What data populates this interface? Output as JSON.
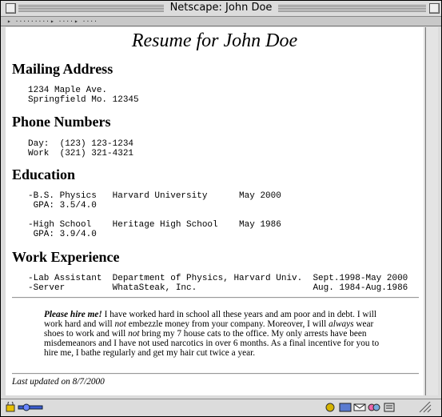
{
  "window": {
    "title": "Netscape: John Doe"
  },
  "tabs": [
    "▸ ·········",
    "▸ ····",
    "▸ ····"
  ],
  "resume": {
    "heading": "Resume for John Doe",
    "sections": {
      "mailing": {
        "title": "Mailing Address",
        "lines": [
          "1234 Maple Ave.",
          "Springfield Mo. 12345"
        ]
      },
      "phone": {
        "title": "Phone Numbers",
        "lines": [
          "Day:  (123) 123-1234",
          "Work  (321) 321-4321"
        ]
      },
      "education": {
        "title": "Education",
        "entries": [
          {
            "line1": "-B.S. Physics   Harvard University      May 2000",
            "line2": " GPA: 3.5/4.0"
          },
          {
            "line1": "-High School    Heritage High School    May 1986",
            "line2": " GPA: 3.9/4.0"
          }
        ]
      },
      "work": {
        "title": "Work Experience",
        "lines": [
          "-Lab Assistant  Department of Physics, Harvard Univ.  Sept.1998-May 2000",
          "-Server         WhataSteak, Inc.                      Aug. 1984-Aug.1986"
        ]
      }
    },
    "plea": {
      "lead": "Please hire me!",
      "t1": " I have worked hard in school all these years and am poor and in debt. I will work hard and will ",
      "em1": "not",
      "t2": " embezzle money from your company. Moreover, I will ",
      "em2": "always",
      "t3": " wear shoes to work and will ",
      "em3": "not",
      "t4": " bring my 7 house cats to the office. My only arrests have been misdemeanors and I have not used narcotics in over 6 months. As a final incentive for you to hire me, I bathe regularly and get my hair cut twice a year."
    },
    "updated": "Last updated on 8/7/2000"
  },
  "icons": {
    "status_left": [
      "lock-icon",
      "connection-icon"
    ],
    "status_right": [
      "gear-icon",
      "network-icon",
      "mail-icon",
      "group-icon",
      "composer-icon",
      "resize-icon"
    ]
  }
}
